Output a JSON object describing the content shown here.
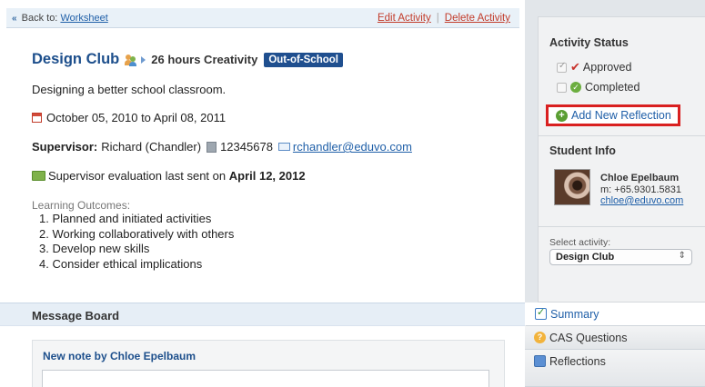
{
  "topbar": {
    "back_prefix": "Back to:",
    "back_link": "Worksheet",
    "edit_label": "Edit Activity",
    "separator": "|",
    "delete_label": "Delete Activity"
  },
  "activity": {
    "title": "Design Club",
    "hours": "26 hours Creativity",
    "tag": "Out-of-School",
    "description": "Designing a better school classroom.",
    "date_range": "October 05, 2010 to April 08, 2011",
    "supervisor_label": "Supervisor:",
    "supervisor_name": "Richard (Chandler)",
    "supervisor_phone": "12345678",
    "supervisor_email": "rchandler@eduvo.com",
    "eval_text": "Supervisor evaluation last sent on",
    "eval_date": "April 12, 2012",
    "learning_outcomes_label": "Learning Outcomes:",
    "learning_outcomes": [
      "1. Planned and initiated activities",
      "2. Working collaboratively with others",
      "3. Develop new skills",
      "4. Consider ethical implications"
    ]
  },
  "message_board": {
    "title": "Message Board",
    "new_note_label": "New note by Chloe Epelbaum"
  },
  "sidebar": {
    "status_title": "Activity Status",
    "approved_label": "Approved",
    "completed_label": "Completed",
    "add_reflection_label": "Add New Reflection",
    "student_info_title": "Student Info",
    "student_name": "Chloe Epelbaum",
    "student_phone": "m: +65.9301.5831",
    "student_email": "chloe@eduvo.com",
    "select_label": "Select activity:",
    "select_value": "Design Club"
  },
  "tabs": [
    {
      "label": "Summary"
    },
    {
      "label": "CAS Questions"
    },
    {
      "label": "Reflections"
    }
  ],
  "colors": {
    "title_blue": "#1d4f8c",
    "link_red": "#c23b2a",
    "highlight_red": "#d92020",
    "tag_bg": "#1f4f8f"
  }
}
